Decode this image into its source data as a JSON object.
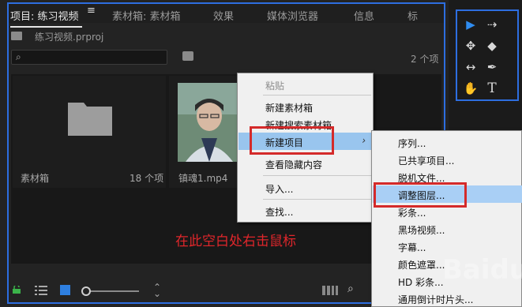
{
  "tabs": [
    {
      "label": "项目: 练习视频",
      "active": true
    },
    {
      "label": "素材箱: 素材箱",
      "active": false
    },
    {
      "label": "效果",
      "active": false
    },
    {
      "label": "媒体浏览器",
      "active": false
    },
    {
      "label": "信息",
      "active": false
    },
    {
      "label": "标",
      "active": false
    }
  ],
  "project": {
    "file_name": "练习视频.prproj",
    "item_count": "2 个项",
    "items": [
      {
        "name": "素材箱",
        "count": "18 个项",
        "icon": "folder-icon"
      },
      {
        "name": "镇魂1.mp4",
        "icon": "video-thumbnail"
      }
    ]
  },
  "instruction": "在此空白处右击鼠标",
  "context_menu": {
    "items": [
      {
        "label": "粘贴",
        "disabled": true
      },
      {
        "label": "新建素材箱"
      },
      {
        "label": "新建搜索素材箱"
      },
      {
        "label": "新建项目",
        "highlighted": true,
        "submenu_arrow": "›"
      },
      {
        "label": "查看隐藏内容"
      },
      {
        "label": "导入..."
      },
      {
        "label": "查找..."
      }
    ],
    "submenu": [
      {
        "label": "序列..."
      },
      {
        "label": "已共享项目..."
      },
      {
        "label": "脱机文件..."
      },
      {
        "label": "调整图层...",
        "highlighted": true
      },
      {
        "label": "彩条..."
      },
      {
        "label": "黑场视频..."
      },
      {
        "label": "字幕..."
      },
      {
        "label": "颜色遮罩..."
      },
      {
        "label": "HD 彩条..."
      },
      {
        "label": "通用倒计时片头..."
      }
    ]
  },
  "watermark": "Baidu",
  "colors": {
    "accent": "#2d6ee0",
    "annotation": "#e0262b",
    "highlight": "#99c5ee"
  }
}
